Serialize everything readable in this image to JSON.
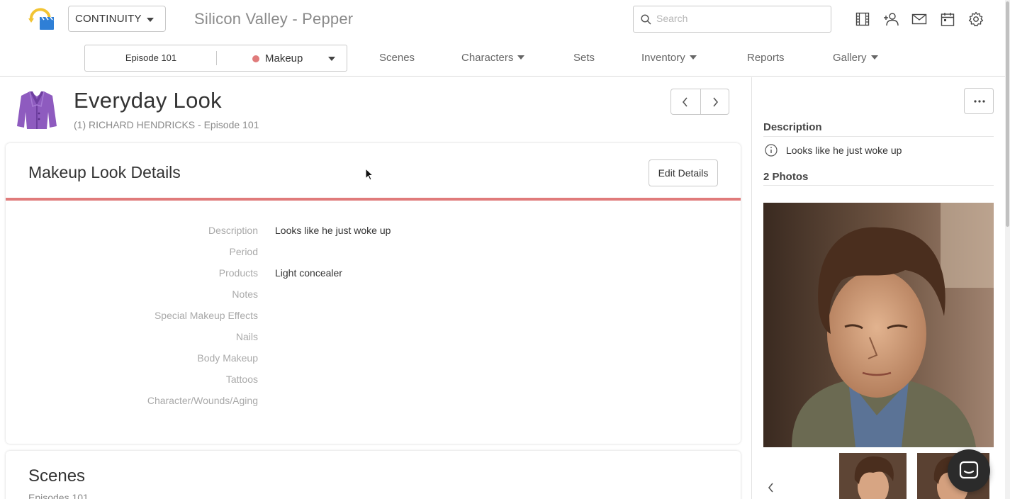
{
  "topbar": {
    "app_label": "CONTINUITY",
    "project_title": "Silicon Valley - Pepper",
    "search_placeholder": "Search",
    "icons": [
      "film-icon",
      "add-user-icon",
      "mail-icon",
      "calendar-icon",
      "gear-icon"
    ]
  },
  "nav": {
    "episode": "Episode 101",
    "department": "Makeup",
    "department_color": "#e07b7b",
    "links": [
      {
        "label": "Scenes",
        "has_caret": false
      },
      {
        "label": "Characters",
        "has_caret": true
      },
      {
        "label": "Sets",
        "has_caret": false
      },
      {
        "label": "Inventory",
        "has_caret": true
      },
      {
        "label": "Reports",
        "has_caret": false
      },
      {
        "label": "Gallery",
        "has_caret": true
      }
    ]
  },
  "look": {
    "title": "Everyday Look",
    "subtitle": "(1) RICHARD HENDRICKS - Episode 101",
    "icon": "jacket-icon",
    "icon_color": "#8e5bbf"
  },
  "details": {
    "title": "Makeup Look Details",
    "edit_label": "Edit Details",
    "accent_color": "#e07b7b",
    "fields": [
      {
        "label": "Description",
        "value": "Looks like he just woke up"
      },
      {
        "label": "Period",
        "value": ""
      },
      {
        "label": "Products",
        "value": "Light concealer"
      },
      {
        "label": "Notes",
        "value": ""
      },
      {
        "label": "Special Makeup Effects",
        "value": ""
      },
      {
        "label": "Nails",
        "value": ""
      },
      {
        "label": "Body Makeup",
        "value": ""
      },
      {
        "label": "Tattoos",
        "value": ""
      },
      {
        "label": "Character/Wounds/Aging",
        "value": ""
      }
    ]
  },
  "scenes": {
    "title": "Scenes",
    "subtitle": "Episodes 101"
  },
  "side_panel": {
    "description_heading": "Description",
    "description_text": "Looks like he just woke up",
    "photos_heading": "2 Photos"
  }
}
